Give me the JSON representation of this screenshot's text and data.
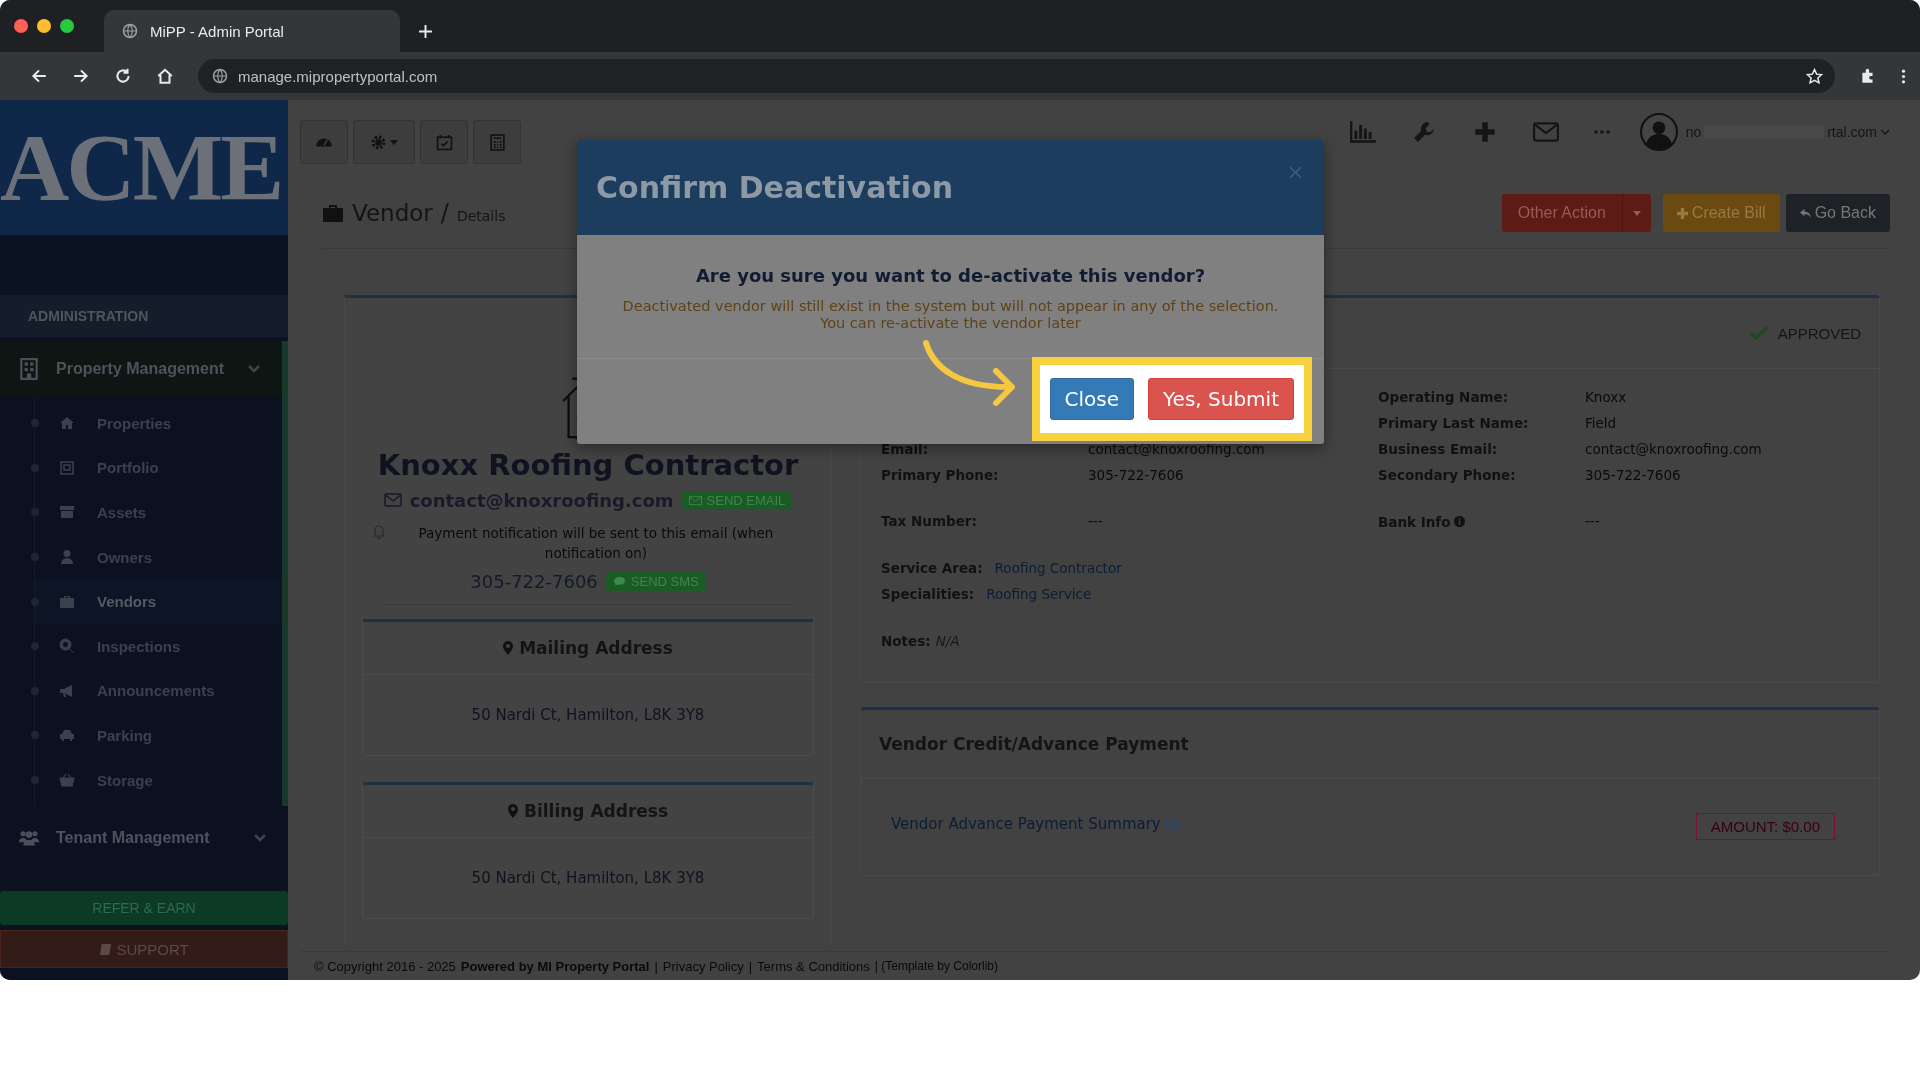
{
  "browser": {
    "tab_title": "MiPP - Admin Portal",
    "url": "manage.mipropertyportal.com"
  },
  "brand": {
    "logo": "ACME"
  },
  "sidebar": {
    "section": "ADMINISTRATION",
    "groups": [
      {
        "label": "Property Management",
        "expanded": true,
        "children": [
          {
            "label": "Properties",
            "selected": false
          },
          {
            "label": "Portfolio",
            "selected": false
          },
          {
            "label": "Assets",
            "selected": false
          },
          {
            "label": "Owners",
            "selected": false
          },
          {
            "label": "Vendors",
            "selected": true
          },
          {
            "label": "Inspections",
            "selected": false
          },
          {
            "label": "Announcements",
            "selected": false
          },
          {
            "label": "Parking",
            "selected": false
          },
          {
            "label": "Storage",
            "selected": false
          }
        ]
      },
      {
        "label": "Tenant Management",
        "expanded": false
      }
    ],
    "refer": "REFER & EARN",
    "support": "SUPPORT"
  },
  "header": {
    "user_start": "no",
    "user_end": "rtal.com"
  },
  "page": {
    "title": "Vendor",
    "separator": "/",
    "crumb": "Details",
    "actions": [
      {
        "label": "Other Action",
        "kind": "split"
      },
      {
        "label": "Create Bill",
        "kind": "add"
      },
      {
        "label": "Go Back",
        "kind": "back"
      }
    ]
  },
  "vendor": {
    "name": "Knoxx Roofing Contractor",
    "email": "contact@knoxroofing.com",
    "send_email": "SEND EMAIL",
    "notice": "Payment notification will be sent to this email (when notification on)",
    "phone": "305-722-7606",
    "send_sms": "SEND SMS",
    "addresses": [
      {
        "title": "Mailing Address",
        "value": "50 Nardi Ct, Hamilton, L8K 3Y8"
      },
      {
        "title": "Billing Address",
        "value": "50 Nardi Ct, Hamilton, L8K 3Y8"
      }
    ]
  },
  "status": {
    "label": "APPROVED",
    "approved": true
  },
  "fields": [
    {
      "right_label": "Operating Name:",
      "right_value": "Knoxx"
    },
    {
      "right_label": "Primary Last Name:",
      "right_value": "Field"
    },
    {
      "left_label": "Email:",
      "left_value": "contact@knoxroofing.com",
      "right_label": "Business Email:",
      "right_value": "contact@knoxroofing.com"
    },
    {
      "left_label": "Primary Phone:",
      "left_value": "305-722-7606",
      "right_label": "Secondary Phone:",
      "right_value": "305-722-7606"
    }
  ],
  "tax": {
    "left_label": "Tax Number:",
    "left_value": "---",
    "right_label": "Bank Info",
    "right_value": "---"
  },
  "areas": [
    {
      "label": "Service Area:",
      "value": "Roofing Contractor"
    },
    {
      "label": "Specialities:",
      "value": "Roofing Service"
    }
  ],
  "notes": {
    "label": "Notes:",
    "value": "N/A"
  },
  "credit": {
    "title": "Vendor Credit/Advance Payment",
    "link": "Vendor Advance Payment Summary",
    "amount": "AMOUNT: $0.00"
  },
  "footer": [
    {
      "text": "© Copyright 2016 - 2025",
      "kind": "text"
    },
    {
      "text": "Powered by MI Property Portal",
      "kind": "strong"
    },
    {
      "text": "|",
      "kind": "text"
    },
    {
      "text": "Privacy Policy",
      "kind": "link"
    },
    {
      "text": "|",
      "kind": "text"
    },
    {
      "text": "Terms & Conditions",
      "kind": "link"
    },
    {
      "text": "| (Template by Colorlib)",
      "kind": "faint"
    }
  ],
  "modal": {
    "title": "Confirm Deactivation",
    "question": "Are you sure you want to de-activate this vendor?",
    "message": "Deactivated vendor will still exist in the system but will not appear in any of the selection.\nYou can re-activate the vendor later",
    "buttons": [
      {
        "label": "Close",
        "kind": "default"
      },
      {
        "label": "Yes, Submit",
        "kind": "danger"
      }
    ]
  }
}
